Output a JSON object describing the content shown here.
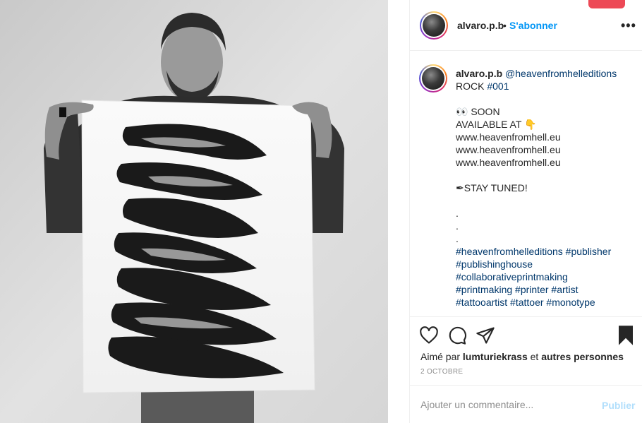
{
  "post": {
    "username": "alvaro.p.b",
    "follow_label": "S'abonner",
    "dot": "•",
    "more_label": "•••"
  },
  "caption": {
    "username": "alvaro.p.b",
    "mention": "@heavenfromhelleditions",
    "title_text": "ROCK ",
    "title_tag": "#001",
    "soon": "👀 SOON",
    "available": "AVAILABLE AT 👇",
    "links": [
      "www.heavenfromhell.eu",
      "www.heavenfromhell.eu",
      "www.heavenfromhell.eu"
    ],
    "stay_tuned": "✒STAY TUNED!",
    "dots": [
      ".",
      ".",
      "."
    ],
    "hashtag_lines": [
      [
        "#heavenfromhelleditions",
        "#publisher"
      ],
      [
        "#publishinghouse"
      ],
      [
        "#collaborativeprintmaking"
      ],
      [
        "#printmaking",
        "#printer",
        "#artist"
      ],
      [
        "#tattooartist",
        "#tattoer",
        "#monotype"
      ]
    ]
  },
  "actions": {
    "like_icon": "heart-icon",
    "comment_icon": "comment-icon",
    "share_icon": "paper-plane-icon",
    "save_icon": "bookmark-icon",
    "liked_prefix": "Aimé par ",
    "liked_user": "lumturiekrass",
    "liked_middle": " et ",
    "liked_others": "autres personnes",
    "date": "2 OCTOBRE"
  },
  "comment": {
    "placeholder": "Ajouter un commentaire...",
    "post_label": "Publier"
  },
  "colors": {
    "accent": "#0095f6",
    "link": "#00376b",
    "muted": "#8e8e8e",
    "post_disabled": "#b2dffc",
    "badge": "#ed4956"
  }
}
